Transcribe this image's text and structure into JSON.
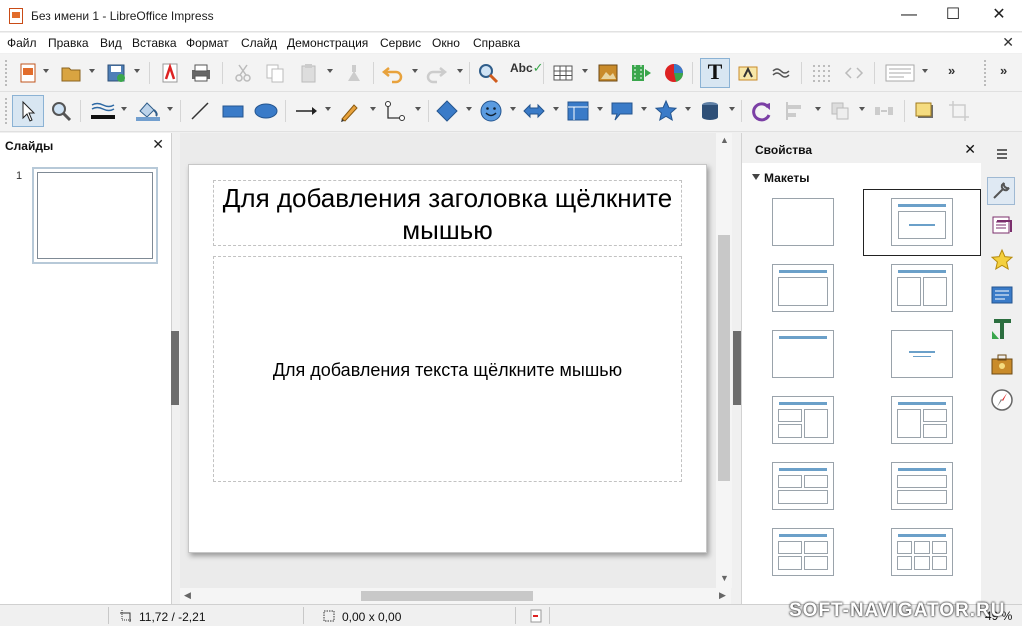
{
  "window": {
    "title": "Без имени 1 - LibreOffice Impress",
    "buttons": [
      "—",
      "☐",
      "✕"
    ]
  },
  "menu": {
    "items": [
      "Файл",
      "Правка",
      "Вид",
      "Вставка",
      "Формат",
      "Слайд",
      "Демонстрация",
      "Сервис",
      "Окно",
      "Справка"
    ],
    "close_document": "✕"
  },
  "toolbar": {
    "more": "»",
    "standard_icons": [
      "new-document-icon",
      "open-folder-icon",
      "save-icon",
      "export-pdf-icon",
      "print-icon",
      "cut-icon",
      "copy-icon",
      "paste-icon",
      "clone-formatting-icon",
      "undo-icon",
      "redo-icon",
      "find-replace-icon",
      "spellcheck-icon",
      "insert-table-icon",
      "insert-image-icon",
      "insert-media-icon",
      "insert-chart-icon",
      "insert-textbox-icon",
      "fontwork-icon",
      "hyperlink-icon",
      "grid-icon",
      "helplines-icon",
      "display-views-icon"
    ],
    "spellcheck_label": "Abc",
    "textbox_label": "T",
    "drawing_icons": [
      "select-icon",
      "zoom-pan-icon",
      "line-color-icon",
      "fill-color-icon",
      "line-icon",
      "rectangle-icon",
      "ellipse-icon",
      "arrow-line-icon",
      "curve-icon",
      "connector-icon",
      "basic-shapes-icon",
      "symbol-shapes-icon",
      "block-arrows-icon",
      "flowchart-icon",
      "callouts-icon",
      "stars-icon",
      "3d-objects-icon",
      "rotate-icon",
      "align-icon",
      "arrange-icon",
      "distribute-icon",
      "shadow-icon",
      "crop-icon"
    ],
    "colors": {
      "line": "#111111",
      "fill": "#729fcf",
      "shape_fill": "#3a7bc8",
      "accent_orange": "#e8a23c"
    }
  },
  "slides_pane": {
    "title": "Слайды",
    "close": "✕",
    "slides": [
      {
        "number": "1"
      }
    ]
  },
  "slide": {
    "title_placeholder": "Для добавления заголовка щёлкните мышью",
    "content_placeholder": "Для добавления текста щёлкните мышью"
  },
  "properties": {
    "title": "Свойства",
    "close": "✕",
    "section": "Макеты",
    "layouts": [
      "blank",
      "title-slide",
      "title-content",
      "title-2-content",
      "title-only",
      "centered-text",
      "title-2-content-and-content",
      "title-content-and-2-content",
      "title-2-content-over-content",
      "title-content-over-content",
      "title-4-content",
      "title-6-content"
    ],
    "selected_layout": "title-slide",
    "deck_icons": [
      "properties-icon",
      "slide-transition-icon",
      "animation-icon",
      "master-slides-icon",
      "styles-icon",
      "gallery-icon",
      "navigator-icon"
    ]
  },
  "statusbar": {
    "position": "11,72 / -2,21",
    "size": "0,00 x 0,00",
    "zoom_fragment": "49 %",
    "watermark": "SOFT-NAVIGATOR.RU"
  }
}
